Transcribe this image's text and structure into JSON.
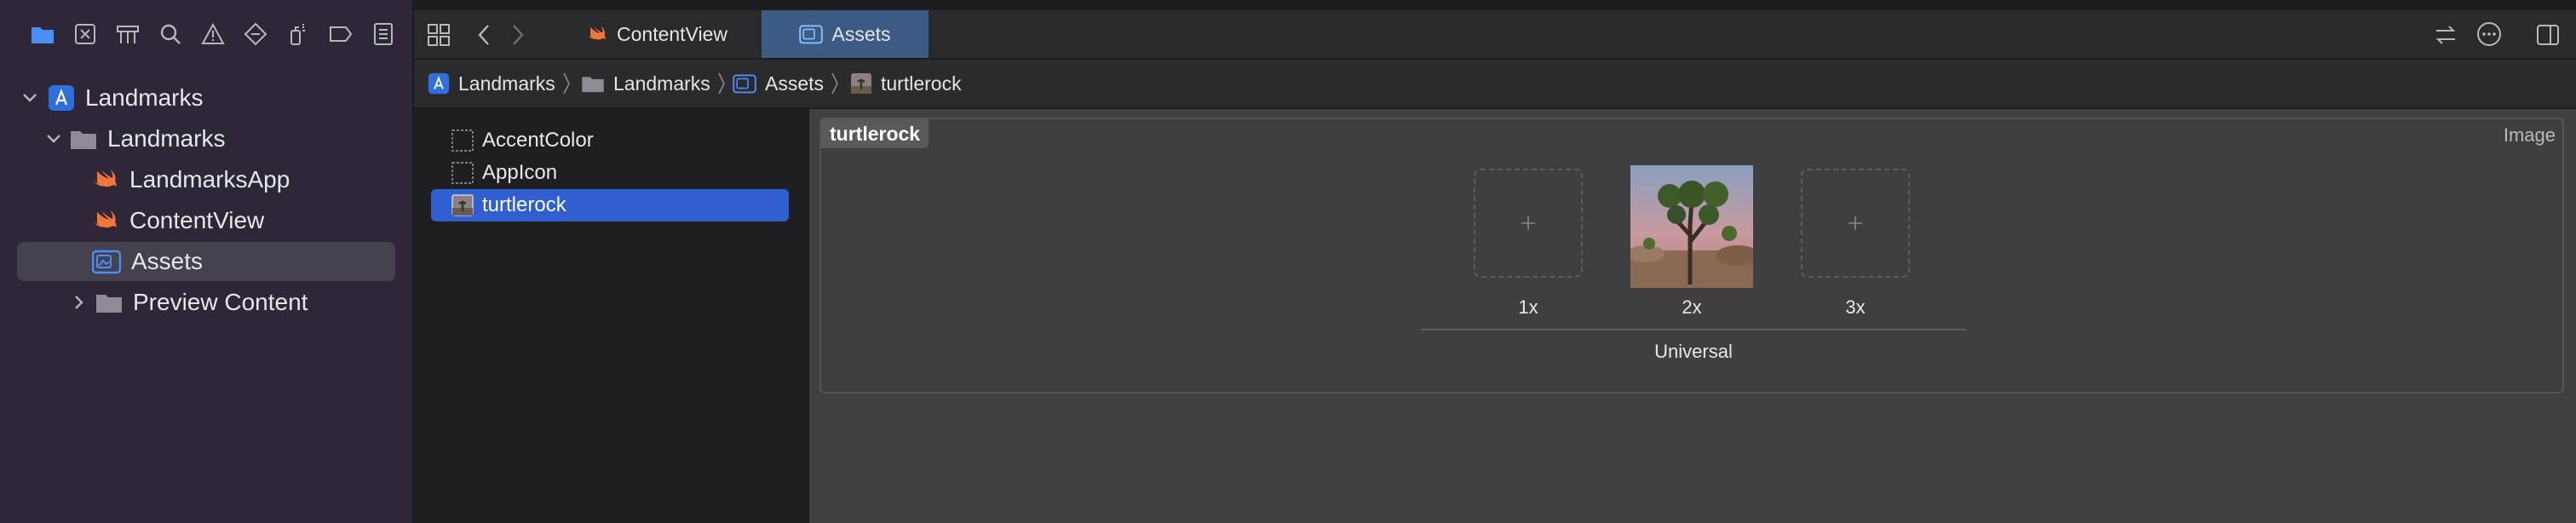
{
  "sidebar": {
    "tree": [
      {
        "label": "Landmarks"
      },
      {
        "label": "Landmarks"
      },
      {
        "label": "LandmarksApp"
      },
      {
        "label": "ContentView"
      },
      {
        "label": "Assets"
      },
      {
        "label": "Preview Content"
      }
    ]
  },
  "tabs": [
    {
      "label": "ContentView"
    },
    {
      "label": "Assets"
    }
  ],
  "breadcrumb": [
    "Landmarks",
    "Landmarks",
    "Assets",
    "turtlerock"
  ],
  "assets": [
    {
      "label": "AccentColor"
    },
    {
      "label": "AppIcon"
    },
    {
      "label": "turtlerock"
    }
  ],
  "editor": {
    "set_name": "turtlerock",
    "set_type": "Image",
    "slots": [
      {
        "label": "1x"
      },
      {
        "label": "2x"
      },
      {
        "label": "3x"
      }
    ],
    "group_label": "Universal"
  },
  "colors": {
    "accent": "#2f5fd1",
    "swift": "#f0763a",
    "folder_blue": "#4a8ff7"
  }
}
